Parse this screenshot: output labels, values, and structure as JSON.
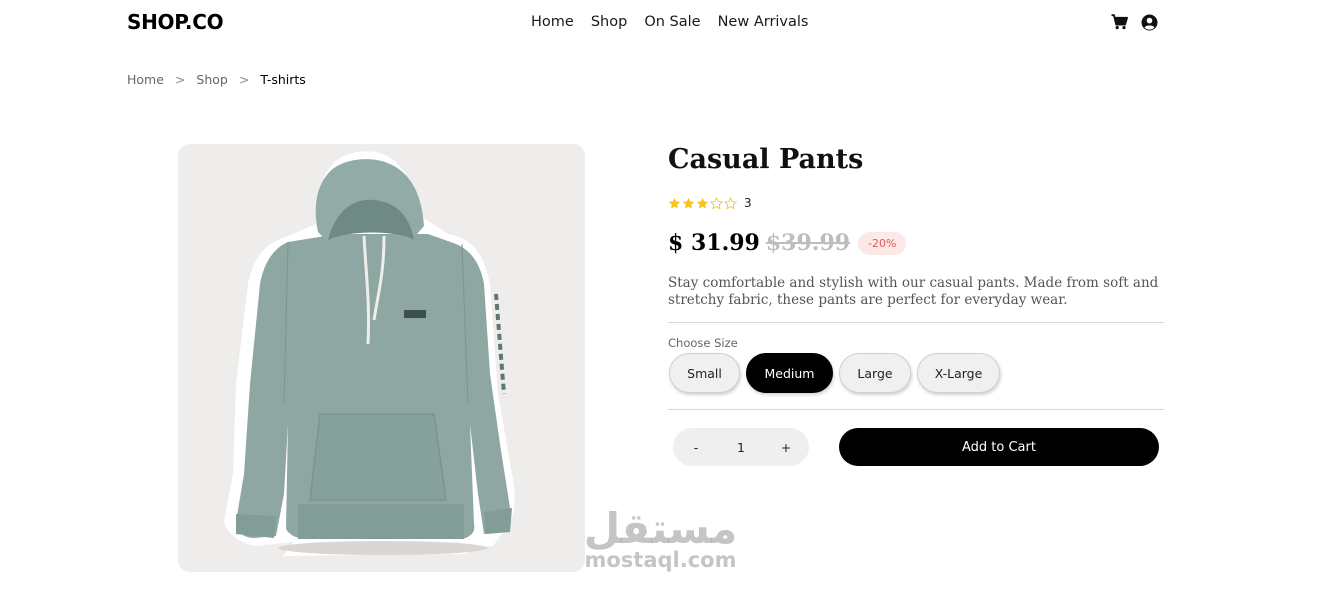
{
  "header": {
    "logo": "SHOP.CO",
    "nav": [
      "Home",
      "Shop",
      "On Sale",
      "New Arrivals"
    ],
    "icons": [
      "cart-icon",
      "user-icon"
    ]
  },
  "breadcrumb": {
    "items": [
      "Home",
      "Shop",
      "T-shirts"
    ],
    "separator": ">"
  },
  "product": {
    "image": "hoodie-photo",
    "title": "Casual Pants",
    "rating": {
      "value": 3,
      "max": 5,
      "count": "3"
    },
    "price_current": "$ 31.99",
    "price_old": "$39.99",
    "discount": "-20%",
    "description": "Stay comfortable and stylish with our casual pants. Made from soft and stretchy fabric, these pants are perfect for everyday wear.",
    "size_label": "Choose Size",
    "sizes": [
      "Small",
      "Medium",
      "Large",
      "X-Large"
    ],
    "selected_size": "Medium",
    "quantity": {
      "decrement": "-",
      "value": "1",
      "increment": "+"
    },
    "add_to_cart": "Add to Cart"
  },
  "watermark": {
    "arabic": "مستقل",
    "latin": "mostaql.com"
  },
  "colors": {
    "accent": "#000000",
    "star": "#f5c518",
    "discount_text": "#e05a5a",
    "discount_bg": "#fde8e8",
    "image_bg": "#efedeb"
  }
}
